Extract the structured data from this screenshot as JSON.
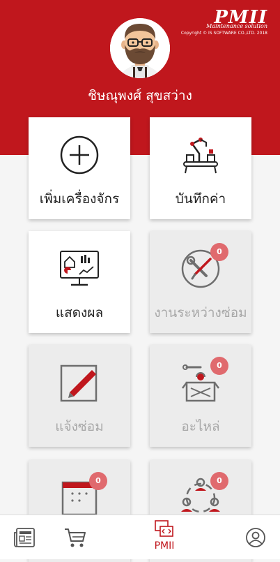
{
  "app": {
    "logo_text": "PMII",
    "logo_subtitle": "Maintenance solution",
    "copyright": "Copyright © IS SOFTWARE CO.,LTD. 2018",
    "brand_color": "#c0171d"
  },
  "user": {
    "name": "ชิษณุพงศ์ สุขสว่าง"
  },
  "tiles": [
    {
      "label": "เพิ่มเครื่องจักร",
      "icon": "plus-circle-icon",
      "enabled": true
    },
    {
      "label": "บันทึกค่า",
      "icon": "robot-conveyor-icon",
      "enabled": true
    },
    {
      "label": "แสดงผล",
      "icon": "dashboard-monitor-icon",
      "enabled": true
    },
    {
      "label": "งานระหว่างซ่อม",
      "icon": "wrench-screwdriver-icon",
      "enabled": false,
      "badge": "0"
    },
    {
      "label": "แจ้งซ่อม",
      "icon": "pencil-note-icon",
      "enabled": false
    },
    {
      "label": "อะไหล่",
      "icon": "parts-box-icon",
      "enabled": false,
      "badge": "0"
    },
    {
      "label": "",
      "icon": "calendar-icon",
      "enabled": false,
      "badge": "0"
    },
    {
      "label": "",
      "icon": "team-network-icon",
      "enabled": false,
      "badge": "0"
    }
  ],
  "bottom_nav": {
    "items": [
      {
        "icon": "news-icon"
      },
      {
        "icon": "cart-icon"
      },
      {
        "icon": "pmii-code-icon",
        "label": "PMII",
        "active": true
      },
      {
        "icon": "profile-icon"
      }
    ]
  }
}
